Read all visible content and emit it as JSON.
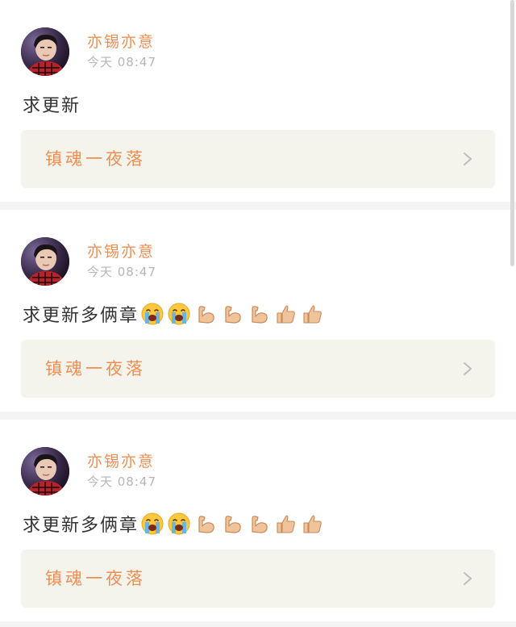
{
  "posts": [
    {
      "author": "亦锡亦意",
      "time": "今天 08:47",
      "comment": "求更新",
      "emojis": [],
      "link_title": "镇魂一夜落"
    },
    {
      "author": "亦锡亦意",
      "time": "今天 08:47",
      "comment": "求更新多俩章",
      "emojis": [
        "crying-face",
        "crying-face",
        "flexed-biceps",
        "flexed-biceps",
        "flexed-biceps",
        "thumbs-up",
        "thumbs-up"
      ],
      "link_title": "镇魂一夜落"
    },
    {
      "author": "亦锡亦意",
      "time": "今天 08:47",
      "comment": "求更新多俩章",
      "emojis": [
        "crying-face",
        "crying-face",
        "flexed-biceps",
        "flexed-biceps",
        "flexed-biceps",
        "thumbs-up",
        "thumbs-up"
      ],
      "link_title": "镇魂一夜落"
    }
  ],
  "colors": {
    "accent": "#ee8e52",
    "time": "#b6b6b6",
    "link_bg": "#f4f4ec",
    "page_bg": "#f4f4f4"
  }
}
